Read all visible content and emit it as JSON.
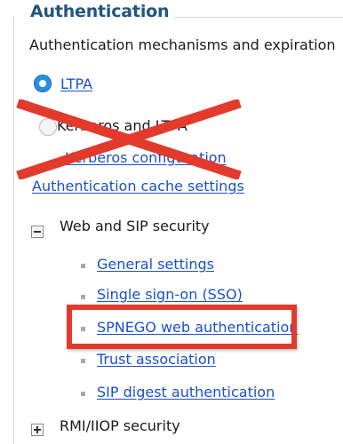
{
  "section": {
    "title": "Authentication",
    "description": "Authentication mechanisms and expiration"
  },
  "mechanisms": {
    "ltpa": {
      "label": "LTPA",
      "selected": true
    },
    "kerberos": {
      "label": "Kerberos and LTPA",
      "selected": false
    },
    "kerberos_configuration": "Kerberos configuration"
  },
  "cache_settings": "Authentication cache settings",
  "web_sip": {
    "label": "Web and SIP security",
    "expanded": true,
    "items": [
      "General settings",
      "Single sign-on (SSO)",
      "SPNEGO web authentication",
      "Trust association",
      "SIP digest authentication"
    ]
  },
  "rmi_iiop": {
    "label": "RMI/IIOP security",
    "expanded": false
  },
  "annotations": {
    "cross_color": "#e23a2b",
    "highlight_color": "#e23a2b",
    "crossed_out": "Kerberos and LTPA",
    "highlighted": "SPNEGO web authentication"
  },
  "colors": {
    "title": "#23557f",
    "link": "#1b50c8",
    "radio_selected": "#2b8fe0"
  },
  "icons": {
    "collapse": "minus-box-icon",
    "expand": "plus-box-icon",
    "bullet": "square-bullet-icon"
  }
}
